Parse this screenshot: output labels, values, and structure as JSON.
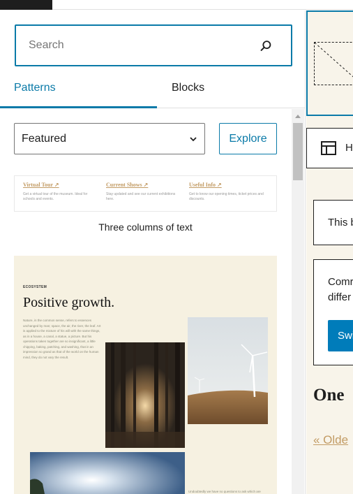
{
  "inserter": {
    "search": {
      "placeholder": "Search",
      "icon": "search-icon"
    },
    "tabs": [
      {
        "label": "Patterns",
        "active": true
      },
      {
        "label": "Blocks",
        "active": false
      }
    ],
    "category_select": {
      "value": "Featured"
    },
    "explore_label": "Explore",
    "patterns": [
      {
        "caption": "Three columns of text",
        "columns": [
          {
            "heading": "Virtual Tour ↗",
            "text": "Get a virtual tour of the museum. Ideal for schools and events."
          },
          {
            "heading": "Current Shows ↗",
            "text": "Stay updated and see our current exhibitions here."
          },
          {
            "heading": "Useful Info ↗",
            "text": "Get to know our opening times, ticket prices and discounts."
          }
        ]
      },
      {
        "eyebrow": "ECOSYSTEM",
        "title": "Positive growth.",
        "body": "Nature, in the common sense, refers to essences unchanged by man; space, the air, the river, the leaf. Art is applied to the mixture of his will with the same things, as in a house, a canal, a statue, a picture. But his operations taken together are so insignificant, a little chipping, baking, patching, and washing, that in an impression so grand as that of the world on the human mind, they do not vary the result.",
        "body2": "Undoubtedly we have no questions to ask which are"
      }
    ]
  },
  "editor": {
    "toolbar_label": "H",
    "notice1": "This b",
    "notice2_line1": "Comr",
    "notice2_line2": "differ",
    "notice2_button": "Swi",
    "heading": "One",
    "older_link": "« Olde"
  },
  "colors": {
    "accent": "#0a7aa8",
    "button": "#007cba",
    "link_gold": "#c29b64",
    "pattern_bg": "#f6f1e1"
  }
}
